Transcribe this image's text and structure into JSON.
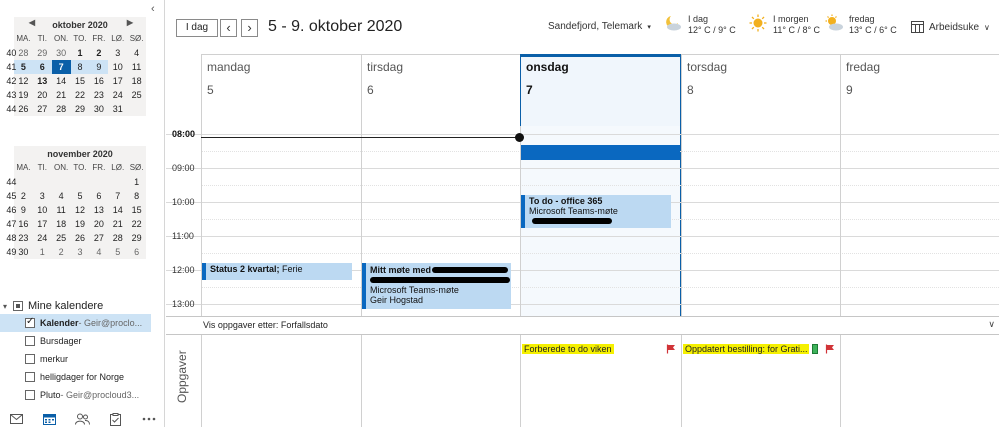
{
  "navpane": {
    "collapse_icon": "chevron-left-icon",
    "mini_calendars": [
      {
        "month_label": "oktober 2020",
        "dow": [
          "MA.",
          "TI.",
          "ON.",
          "TO.",
          "FR.",
          "LØ.",
          "SØ."
        ],
        "weeks": [
          {
            "wk": "40",
            "days": [
              "28",
              "29",
              "30",
              "1",
              "2",
              "3",
              "4"
            ]
          },
          {
            "wk": "41",
            "days": [
              "5",
              "6",
              "7",
              "8",
              "9",
              "10",
              "11"
            ]
          },
          {
            "wk": "42",
            "days": [
              "12",
              "13",
              "14",
              "15",
              "16",
              "17",
              "18"
            ]
          },
          {
            "wk": "43",
            "days": [
              "19",
              "20",
              "21",
              "22",
              "23",
              "24",
              "25"
            ]
          },
          {
            "wk": "44",
            "days": [
              "26",
              "27",
              "28",
              "29",
              "30",
              "31",
              ""
            ]
          }
        ]
      },
      {
        "month_label": "november 2020",
        "dow": [
          "MA.",
          "TI.",
          "ON.",
          "TO.",
          "FR.",
          "LØ.",
          "SØ."
        ],
        "weeks": [
          {
            "wk": "44",
            "days": [
              "",
              "",
              "",
              "",
              "",
              "",
              "1"
            ]
          },
          {
            "wk": "45",
            "days": [
              "2",
              "3",
              "4",
              "5",
              "6",
              "7",
              "8"
            ]
          },
          {
            "wk": "46",
            "days": [
              "9",
              "10",
              "11",
              "12",
              "13",
              "14",
              "15"
            ]
          },
          {
            "wk": "47",
            "days": [
              "16",
              "17",
              "18",
              "19",
              "20",
              "21",
              "22"
            ]
          },
          {
            "wk": "48",
            "days": [
              "23",
              "24",
              "25",
              "26",
              "27",
              "28",
              "29"
            ]
          },
          {
            "wk": "49",
            "days": [
              "30",
              "1",
              "2",
              "3",
              "4",
              "5",
              "6"
            ]
          }
        ]
      }
    ],
    "my_calendars_label": "Mine kalendere",
    "calendars": [
      {
        "name": "Kalender",
        "owner": " - Geir@proclo...",
        "checked": true,
        "selected": true
      },
      {
        "name": "Bursdager",
        "owner": "",
        "checked": false,
        "selected": false
      },
      {
        "name": "merkur",
        "owner": "",
        "checked": false,
        "selected": false
      },
      {
        "name": "helligdager for Norge",
        "owner": "",
        "checked": false,
        "selected": false
      },
      {
        "name": "Pluto",
        "owner": " - Geir@procloud3...",
        "checked": false,
        "selected": false
      }
    ],
    "bottom_nav": [
      "mail-icon",
      "calendar-icon",
      "people-icon",
      "tasks-icon",
      "more-icon"
    ]
  },
  "toolbar": {
    "today_label": "I dag",
    "prev_icon": "chevron-left-icon",
    "next_icon": "chevron-right-icon",
    "range_title": "5 - 9. oktober 2020",
    "location": "Sandefjord, Telemark",
    "weather": [
      {
        "day": "I dag",
        "temps": "12° C / 9° C",
        "icon": "partly-cloudy-night-icon"
      },
      {
        "day": "I morgen",
        "temps": "11° C / 8° C",
        "icon": "sunny-icon"
      },
      {
        "day": "fredag",
        "temps": "13° C / 6° C",
        "icon": "partly-sunny-icon"
      }
    ],
    "view_label": "Arbeidsuke",
    "view_icon": "calendar-view-icon"
  },
  "days": [
    {
      "name": "mandag",
      "date": "5",
      "today": false
    },
    {
      "name": "tirsdag",
      "date": "6",
      "today": false
    },
    {
      "name": "onsdag",
      "date": "7",
      "today": true
    },
    {
      "name": "torsdag",
      "date": "8",
      "today": false
    },
    {
      "name": "fredag",
      "date": "9",
      "today": false
    }
  ],
  "times": [
    "08:00",
    "09:00",
    "10:00",
    "11:00",
    "12:00",
    "13:00"
  ],
  "events": [
    {
      "day": 0,
      "title": "Status 2 kvartal;",
      "sub": " Ferie",
      "line2": "",
      "line3": ""
    },
    {
      "day": 1,
      "title": "Mitt møte med",
      "sub": "",
      "line2": "Microsoft Teams-møte",
      "line3": "Geir Hogstad"
    },
    {
      "day": 2,
      "title": "To do - office 365",
      "sub": "",
      "line2": "Microsoft Teams-møte",
      "line3": ""
    }
  ],
  "tasks_bar": {
    "label": "Vis oppgaver etter: Forfallsdato",
    "side_label": "Oppgaver"
  },
  "tasks": [
    {
      "day": 2,
      "title": "Forberede to do viken",
      "flag_icon": "red-flag-icon"
    },
    {
      "day": 3,
      "title": "Oppdatert bestilling:  for Grati...",
      "flag_icon": "red-flag-icon",
      "category_icon": "green-category-icon"
    }
  ],
  "colors": {
    "accent": "#0a5fa8",
    "event_bg": "#bcd9f2",
    "event_bar": "#0a68c0",
    "highlight": "#f5f000",
    "flag": "#d13438",
    "category": "#3eb35b"
  }
}
